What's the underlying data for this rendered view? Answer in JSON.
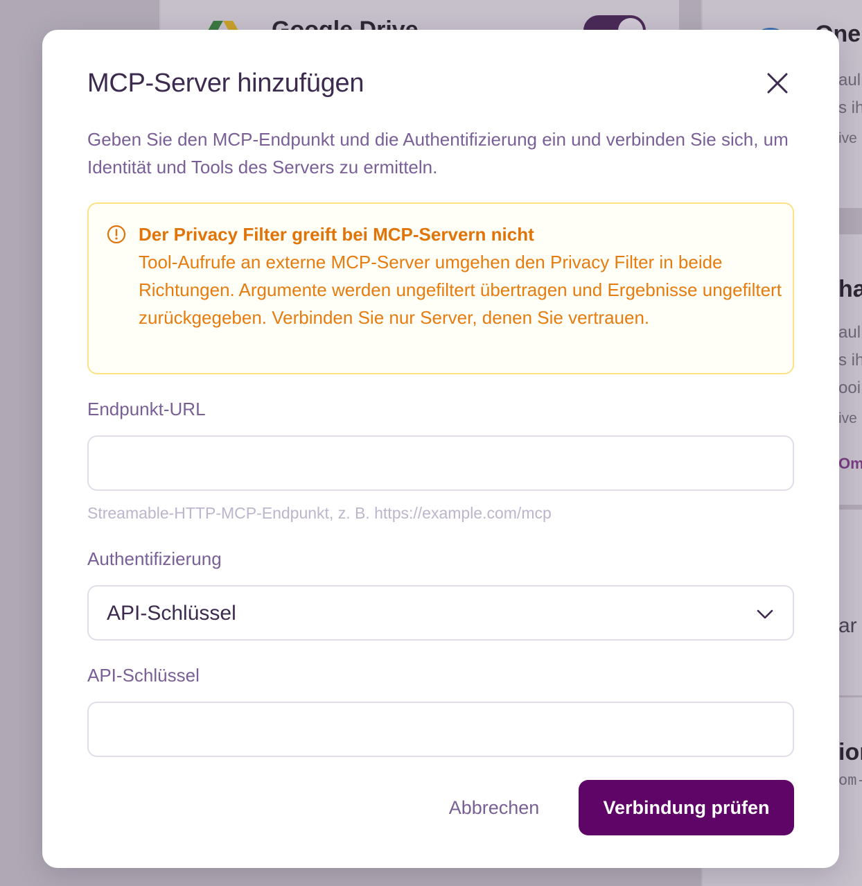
{
  "background": {
    "card1_title": "Google Drive",
    "card2_title": "One",
    "card2_line1": "aul",
    "card2_line2": "s ih",
    "card2_line3": "ive",
    "card3_title": "har",
    "card3_line1": "aul",
    "card3_line2": "s ih",
    "card3_line3": "ooi",
    "card3_line4": "ive",
    "card3_link": "Om",
    "card4_text": "ar",
    "card5_title": "ior",
    "card5_mono": "om-"
  },
  "modal": {
    "title": "MCP-Server hinzufügen",
    "description": "Geben Sie den MCP-Endpunkt und die Authentifizierung ein und verbinden Sie sich, um Identität und Tools des Servers zu ermitteln.",
    "warning": {
      "title": "Der Privacy Filter greift bei MCP-Servern nicht",
      "body": "Tool-Aufrufe an externe MCP-Server umgehen den Privacy Filter in beide Richtungen. Argumente werden ungefiltert übertragen und Ergebnisse ungefiltert zurückgegeben. Verbinden Sie nur Server, denen Sie vertrauen."
    },
    "endpoint": {
      "label": "Endpunkt-URL",
      "value": "",
      "hint": "Streamable-HTTP-MCP-Endpunkt, z. B. https://example.com/mcp"
    },
    "auth": {
      "label": "Authentifizierung",
      "selected": "API-Schlüssel"
    },
    "api_key": {
      "label": "API-Schlüssel",
      "value": ""
    },
    "buttons": {
      "cancel": "Abbrechen",
      "submit": "Verbindung prüfen"
    }
  },
  "colors": {
    "primary": "#5e0567",
    "warning_text": "#e07409",
    "warning_border": "#fce186",
    "muted_text": "#7a5f96"
  }
}
